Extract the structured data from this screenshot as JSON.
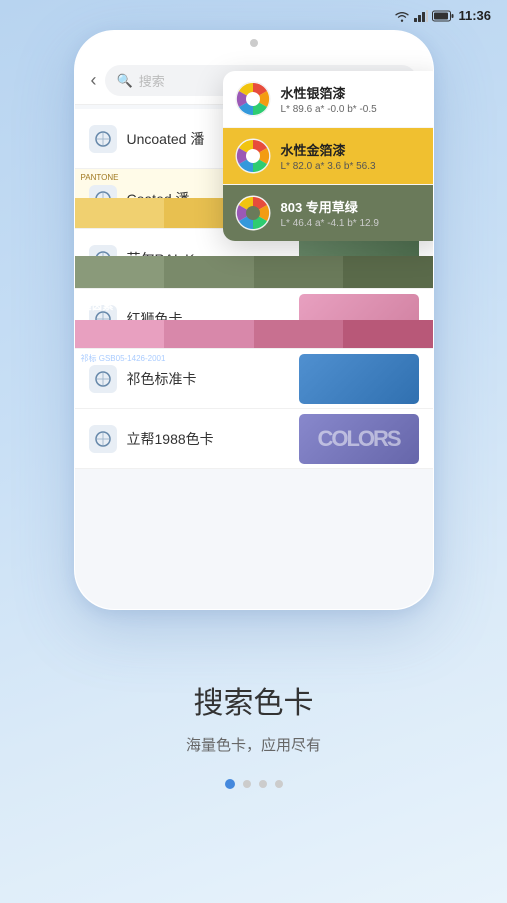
{
  "statusBar": {
    "time": "11:36",
    "wifiIcon": "wifi",
    "signalIcon": "signal",
    "batteryIcon": "battery"
  },
  "phone": {
    "searchPlaceholder": "搜索",
    "cards": [
      {
        "id": "uncoated",
        "label": "Uncoated 潘",
        "thumbType": "uncoated"
      },
      {
        "id": "coated",
        "label": "Coated 潘",
        "thumbType": "coated"
      },
      {
        "id": "ral",
        "label": "劳尔RAL K",
        "thumbType": "ral"
      },
      {
        "id": "lion",
        "label": "红狮色卡",
        "thumbType": "lion"
      },
      {
        "id": "zhu",
        "label": "祁色标准卡",
        "thumbType": "zhu"
      },
      {
        "id": "lipu",
        "label": "立帮1988色卡",
        "thumbType": "lipu"
      }
    ],
    "dropdown": {
      "items": [
        {
          "id": "item1",
          "name": "水性银箔漆",
          "lab": "L* 89.6  a* -0.0  b* -0.5",
          "type": "normal"
        },
        {
          "id": "item2",
          "name": "水性金箔漆",
          "lab": "L* 82.0  a* 3.6  b* 56.3",
          "type": "active"
        },
        {
          "id": "item3",
          "name": "803  专用草绿",
          "lab": "L* 46.4  a* -4.1  b* 12.9",
          "type": "dark"
        }
      ]
    }
  },
  "bottomSection": {
    "title": "搜索色卡",
    "subtitle": "海量色卡，应用尽有",
    "dots": [
      {
        "active": true
      },
      {
        "active": false
      },
      {
        "active": false
      },
      {
        "active": false
      }
    ]
  }
}
